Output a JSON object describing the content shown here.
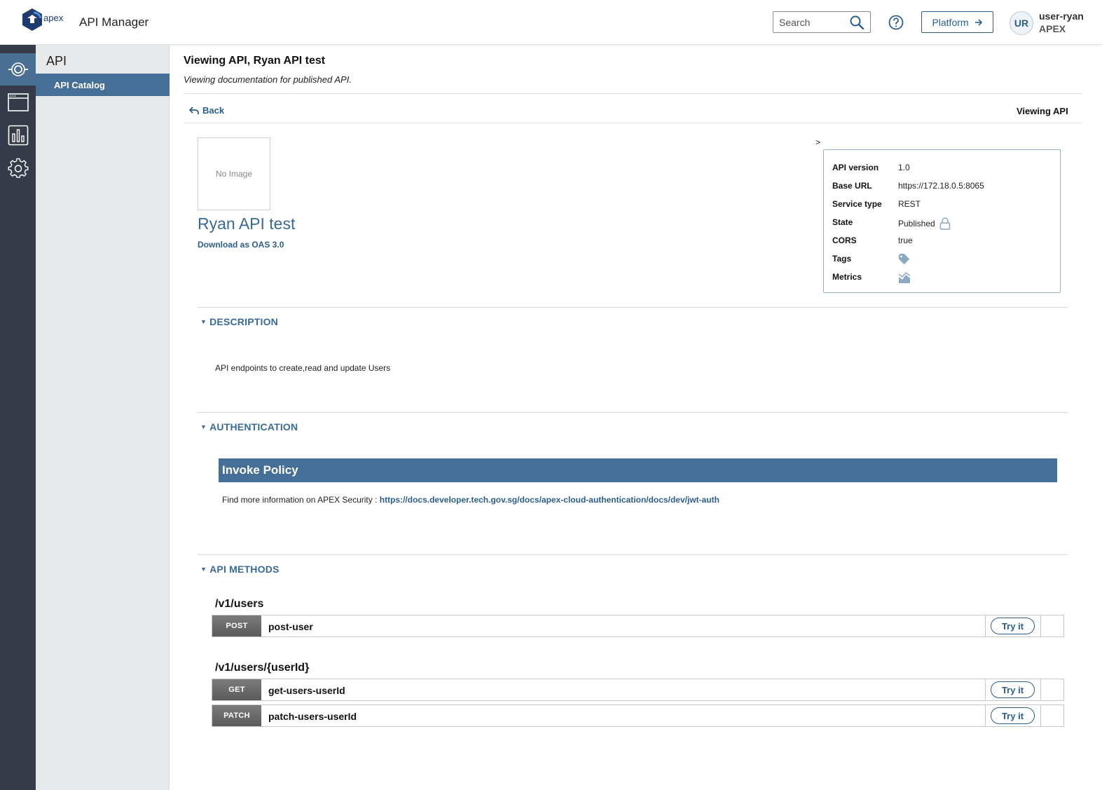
{
  "header": {
    "logo_text": "apex",
    "app_title": "API Manager",
    "search_placeholder": "Search",
    "platform_label": "Platform",
    "avatar_initials": "UR",
    "user_name": "user-ryan",
    "user_org": "APEX"
  },
  "rail": {
    "items": [
      "api-icon",
      "browser-window-icon",
      "bar-chart-icon",
      "gear-icon"
    ],
    "active_index": 0
  },
  "sidebar": {
    "title": "API",
    "items": [
      {
        "label": "API Catalog",
        "active": true
      }
    ]
  },
  "page": {
    "title": "Viewing API, Ryan API test",
    "subtitle": "Viewing documentation for published API.",
    "back_label": "Back",
    "breadcrumb": "Viewing API"
  },
  "api": {
    "image_placeholder": "No Image",
    "name": "Ryan API test",
    "download_label": "Download as OAS 3.0",
    "toggle_marker": ">",
    "info": [
      {
        "label": "API version",
        "value": "1.0"
      },
      {
        "label": "Base URL",
        "value": "https://172.18.0.5:8065"
      },
      {
        "label": "Service type",
        "value": "REST"
      },
      {
        "label": "State",
        "value": "Published",
        "icon": "lock-icon"
      },
      {
        "label": "CORS",
        "value": "true"
      },
      {
        "label": "Tags",
        "value": "",
        "icon": "tag-icon"
      },
      {
        "label": "Metrics",
        "value": "",
        "icon": "metrics-icon"
      }
    ]
  },
  "sections": {
    "description": {
      "heading": "DESCRIPTION",
      "text": "API endpoints to create,read and update Users"
    },
    "authentication": {
      "heading": "AUTHENTICATION",
      "policy_title": "Invoke Policy",
      "info_prefix": "Find more information on APEX Security : ",
      "info_link": "https://docs.developer.tech.gov.sg/docs/apex-cloud-authentication/docs/dev/jwt-auth"
    },
    "methods": {
      "heading": "API METHODS",
      "try_label": "Try it",
      "groups": [
        {
          "path": "/v1/users",
          "methods": [
            {
              "verb": "POST",
              "name": "post-user"
            }
          ]
        },
        {
          "path": "/v1/users/{userId}",
          "methods": [
            {
              "verb": "GET",
              "name": "get-users-userId"
            },
            {
              "verb": "PATCH",
              "name": "patch-users-userId"
            }
          ]
        }
      ]
    }
  },
  "colors": {
    "accent": "#2b5e8c",
    "policy_bar": "#456f96",
    "rail_bg": "#353b48"
  }
}
